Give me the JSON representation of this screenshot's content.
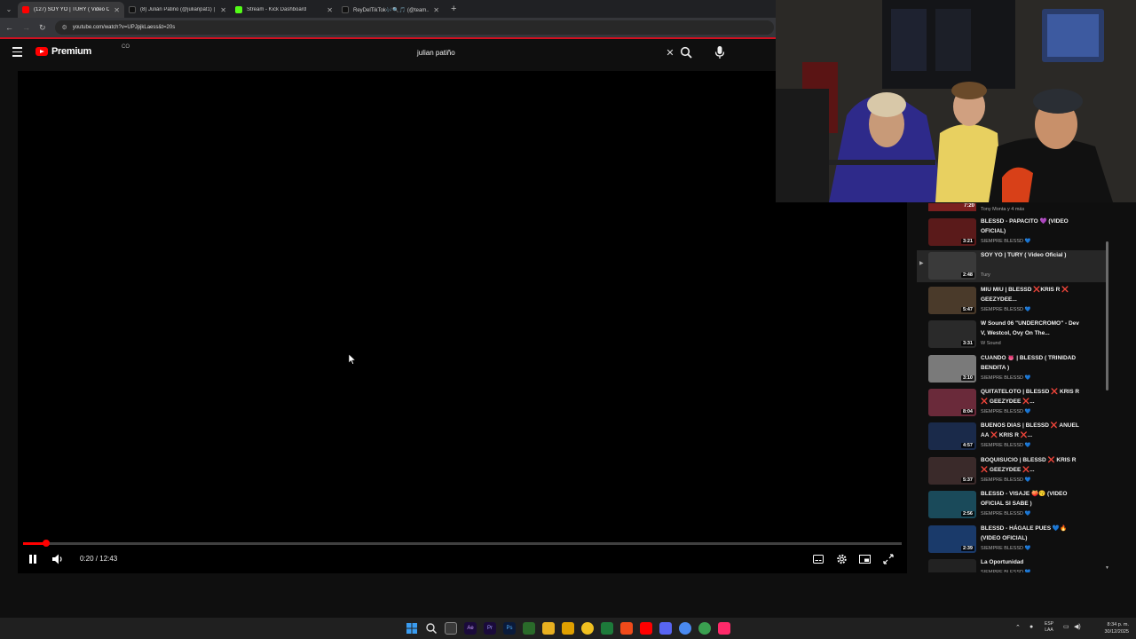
{
  "browser": {
    "tabs": [
      {
        "label": "(127) SOY YO | TURY ( Video Of...",
        "color": "#ff0000",
        "active": true
      },
      {
        "label": "(8) Julián Patiño (@julianpat1) |",
        "color": "#1a1a1a",
        "active": false
      },
      {
        "label": "Stream - Kick Dashboard",
        "color": "#53fc18",
        "active": false
      },
      {
        "label": "ReyDelTikTok🎶🔍🎵 (@team...",
        "color": "#1a1a1a",
        "active": false
      }
    ],
    "new_tab": "+",
    "url": "youtube.com/watch?v=UPJpjkLaess&t=20s"
  },
  "youtube": {
    "logo_text": "Premium",
    "logo_sup": "CO",
    "search_value": "julian patiño"
  },
  "player": {
    "time_display": "0:20 / 12:43",
    "progress_fraction": 0.026
  },
  "playlist": {
    "top_item": {
      "duration": "7:20",
      "channel": "Tony Monta y 4 más"
    },
    "items": [
      {
        "title": "BLESSD - PAPACITO 💜 (VIDEO OFICIAL)",
        "channel": "SIEMPRE BLESSD 💙",
        "duration": "3:21",
        "active": false,
        "thumb": "#5a1a1a"
      },
      {
        "title": "SOY YO | TURY ( Video Oficial )",
        "channel": "Tury",
        "duration": "2:48",
        "active": true,
        "thumb": "#3a3a3a"
      },
      {
        "title": "MIU MIU | BLESSD ❌KRIS R ❌ GEEZYDEE...",
        "channel": "SIEMPRE BLESSD 💙",
        "duration": "5:47",
        "active": false,
        "thumb": "#4a3a2a"
      },
      {
        "title": "W Sound 06 \"UNDERCROMO\" - Dev V, Westcol, Ovy On The...",
        "channel": "W Sound",
        "duration": "3:31",
        "active": false,
        "thumb": "#2a2a2a"
      },
      {
        "title": "CUANDO 👅 | BLESSD ( TRINIDAD BENDITA )",
        "channel": "SIEMPRE BLESSD 💙",
        "duration": "3:10",
        "active": false,
        "thumb": "#7a7a7a"
      },
      {
        "title": "QUITATELOTO | BLESSD ❌ KRIS R ❌ GEEZYDEE ❌...",
        "channel": "SIEMPRE BLESSD 💙",
        "duration": "8:04",
        "active": false,
        "thumb": "#6a2a3a"
      },
      {
        "title": "BUENOS DIAS | BLESSD ❌ ANUEL AA ❌ KRIS R ❌...",
        "channel": "SIEMPRE BLESSD 💙",
        "duration": "4:57",
        "active": false,
        "thumb": "#1a2a4a"
      },
      {
        "title": "BOQUISUCIO | BLESSD ❌ KRIS R ❌ GEEZYDEE ❌...",
        "channel": "SIEMPRE BLESSD 💙",
        "duration": "5:37",
        "active": false,
        "thumb": "#3a2a2a"
      },
      {
        "title": "BLESSD - VISAJE 🍑😗 (VIDEO OFICIAL SI SABE )",
        "channel": "SIEMPRE BLESSD 💙",
        "duration": "2:56",
        "active": false,
        "thumb": "#1a4a5a"
      },
      {
        "title": "BLESSD - HÁGALE PUES 💙🔥 (VIDEO OFICIAL)",
        "channel": "SIEMPRE BLESSD 💙",
        "duration": "2:39",
        "active": false,
        "thumb": "#1a3a6a"
      },
      {
        "title": "La Oportunidad",
        "channel": "SIEMPRE BLESSD 💙",
        "duration": "",
        "active": false,
        "thumb": "#222222"
      }
    ]
  },
  "taskbar": {
    "lang": "ESP",
    "lang2": "LAA",
    "time": "8:34 p. m.",
    "date": "30/12/2025"
  },
  "colors": {
    "accent_red": "#ff0000",
    "bg": "#0f0f0f"
  }
}
